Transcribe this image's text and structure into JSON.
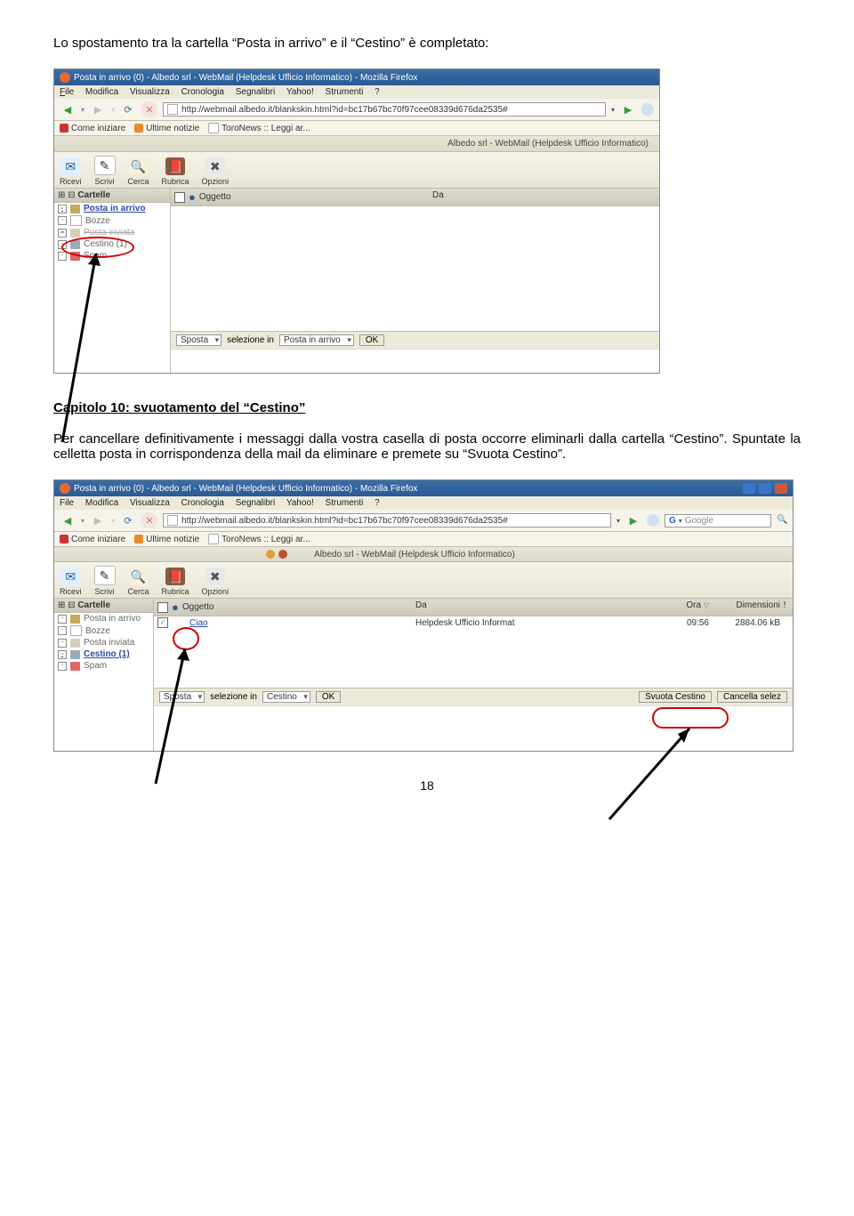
{
  "intro": "Lo spostamento tra la cartella “Posta in arrivo” e il “Cestino” è completato:",
  "chapter": "Capitolo 10: svuotamento del “Cestino”",
  "chapterBody": "Per cancellare definitivamente i messaggi dalla vostra casella di posta occorre eliminarli dalla cartella “Cestino”. Spuntate la celletta posta in corrispondenza della mail da eliminare e premete su “Svuota Cestino”.",
  "pageNumber": "18",
  "shot1": {
    "winTitle": "Posta in arrivo (0) - Albedo srl - WebMail (Helpdesk Ufficio Informatico) - Mozilla Firefox",
    "menu": {
      "file": "File",
      "modifica": "Modifica",
      "visualizza": "Visualizza",
      "cronologia": "Cronologia",
      "segnalibri": "Segnalibri",
      "yahoo": "Yahoo!",
      "strumenti": "Strumenti",
      "help": "?"
    },
    "url": "http://webmail.albedo.it/blankskin.html?id=bc17b67bc70f97cee08339d676da2535#",
    "bookmarks": {
      "start": "Come iniziare",
      "news": "Ultime notizie",
      "toro": "ToroNews :: Leggi ar..."
    },
    "appTitle": "Albedo srl - WebMail (Helpdesk Ufficio Informatico)",
    "tools": {
      "ricevi": "Ricevi",
      "scrivi": "Scrivi",
      "cerca": "Cerca",
      "rubrica": "Rubrica",
      "opzioni": "Opzioni"
    },
    "foldersHeader": "Cartelle",
    "folders": {
      "inbox": "Posta in arrivo",
      "drafts": "Bozze",
      "sent": "Posta inviata",
      "trash": "Cestino (1)",
      "spam": "Spam"
    },
    "listHeaders": {
      "subject": "Oggetto",
      "from": "Da"
    },
    "status": {
      "sposta": "Sposta",
      "seltxt": "selezione in",
      "dest": "Posta in arrivo",
      "ok": "OK"
    }
  },
  "shot2": {
    "winTitle": "Posta in arrivo (0) - Albedo srl - WebMail (Helpdesk Ufficio Informatico) - Mozilla Firefox",
    "menu": {
      "file": "File",
      "modifica": "Modifica",
      "visualizza": "Visualizza",
      "cronologia": "Cronologia",
      "segnalibri": "Segnalibri",
      "yahoo": "Yahoo!",
      "strumenti": "Strumenti",
      "help": "?"
    },
    "url": "http://webmail.albedo.it/blankskin.html?id=bc17b67bc70f97cee08339d676da2535#",
    "search": "Google",
    "bookmarks": {
      "start": "Come iniziare",
      "news": "Ultime notizie",
      "toro": "ToroNews :: Leggi ar..."
    },
    "appTitle": "Albedo srl - WebMail (Helpdesk Ufficio Informatico)",
    "tools": {
      "ricevi": "Ricevi",
      "scrivi": "Scrivi",
      "cerca": "Cerca",
      "rubrica": "Rubrica",
      "opzioni": "Opzioni"
    },
    "foldersHeader": "Cartelle",
    "folders": {
      "inbox": "Posta in arrivo",
      "drafts": "Bozze",
      "sent": "Posta inviata",
      "trash": "Cestino (1)",
      "spam": "Spam"
    },
    "listHeaders": {
      "subject": "Oggetto",
      "from": "Da",
      "time": "Ora",
      "size": "Dimensioni"
    },
    "row": {
      "subject": "Ciao",
      "from": "Helpdesk Ufficio Informat",
      "time": "09:56",
      "size": "2884.06 kB"
    },
    "status": {
      "sposta": "Sposta",
      "seltxt": "selezione in",
      "dest": "Cestino",
      "ok": "OK",
      "svuota": "Svuota Cestino",
      "cancella": "Cancella selez"
    }
  }
}
